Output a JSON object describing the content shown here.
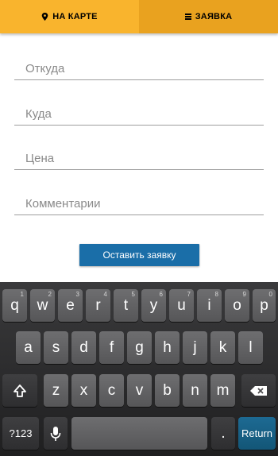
{
  "tabs": [
    {
      "label": "НА КАРТЕ",
      "icon": "map-pin-icon"
    },
    {
      "label": "ЗАЯВКА",
      "icon": "menu-icon"
    }
  ],
  "form": {
    "from_placeholder": "Откуда",
    "to_placeholder": "Куда",
    "price_placeholder": "Цена",
    "comments_placeholder": "Комментарии",
    "submit_label": "Оставить заявку"
  },
  "keyboard": {
    "row1": [
      {
        "char": "q",
        "num": "1"
      },
      {
        "char": "w",
        "num": "2"
      },
      {
        "char": "e",
        "num": "3"
      },
      {
        "char": "r",
        "num": "4"
      },
      {
        "char": "t",
        "num": "5"
      },
      {
        "char": "y",
        "num": "6"
      },
      {
        "char": "u",
        "num": "7"
      },
      {
        "char": "i",
        "num": "8"
      },
      {
        "char": "o",
        "num": "9"
      },
      {
        "char": "p",
        "num": "0"
      }
    ],
    "row2": [
      "a",
      "s",
      "d",
      "f",
      "g",
      "h",
      "j",
      "k",
      "l"
    ],
    "row3": [
      "z",
      "x",
      "c",
      "v",
      "b",
      "n",
      "m"
    ],
    "symbols_label": "?123",
    "period_label": ".",
    "return_label": "Return"
  },
  "colors": {
    "tab_active": "#f9b42d",
    "tab_inactive": "#e9a21f",
    "button": "#1a6ea8",
    "return_key": "#1d6a93"
  }
}
